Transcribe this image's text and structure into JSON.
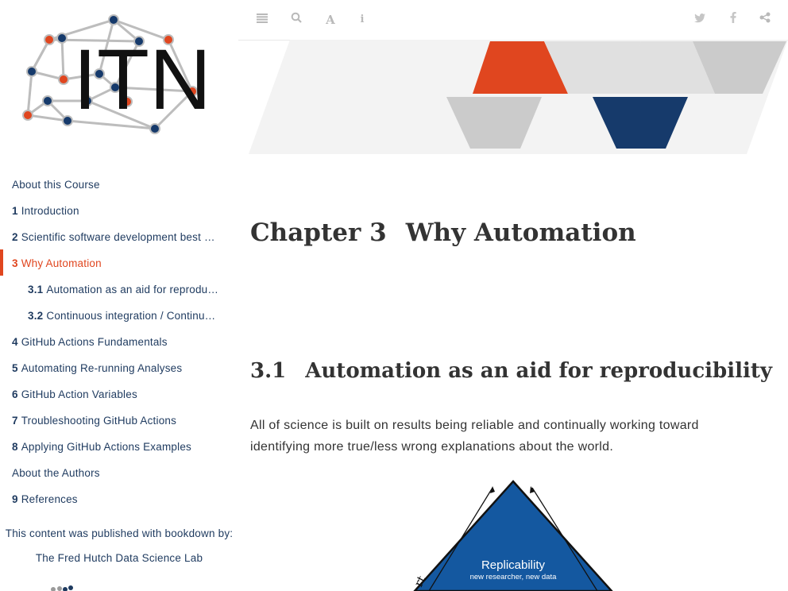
{
  "logo": {
    "text": "ITN"
  },
  "toolbar": {
    "left_icons": [
      "menu-icon",
      "search-icon",
      "font-icon",
      "info-icon"
    ],
    "right_icons": [
      "twitter-icon",
      "facebook-icon",
      "share-icon"
    ]
  },
  "toc": [
    {
      "num": "",
      "label": "About this Course"
    },
    {
      "num": "1",
      "label": "Introduction"
    },
    {
      "num": "2",
      "label": "Scientific software development best …"
    },
    {
      "num": "3",
      "label": "Why Automation"
    },
    {
      "num": "3.1",
      "label": "Automation as an aid for reprodu…"
    },
    {
      "num": "3.2",
      "label": "Continuous integration / Continu…"
    },
    {
      "num": "4",
      "label": "GitHub Actions Fundamentals"
    },
    {
      "num": "5",
      "label": "Automating Re-running Analyses"
    },
    {
      "num": "6",
      "label": "GitHub Action Variables"
    },
    {
      "num": "7",
      "label": "Troubleshooting GitHub Actions"
    },
    {
      "num": "8",
      "label": "Applying GitHub Actions Examples"
    },
    {
      "num": "",
      "label": "About the Authors"
    },
    {
      "num": "9",
      "label": "References"
    }
  ],
  "published": "This content was published with bookdown by:",
  "lab": "The Fred Hutch Data Science Lab",
  "chapter": {
    "prefix": "Chapter 3",
    "title": "Why Automation"
  },
  "section": {
    "num": "3.1",
    "title": "Automation as an aid for reproducibility"
  },
  "body_text": "All of science is built on results being reliable and continually working toward identifying more true/less wrong explanations about the world.",
  "figure": {
    "label": "Replicability",
    "sublabel": "new researcher, new data",
    "side_text": "rt"
  },
  "colors": {
    "accent": "#e0461f",
    "navy": "#1e3a5f",
    "figure_blue": "#1458a0"
  }
}
